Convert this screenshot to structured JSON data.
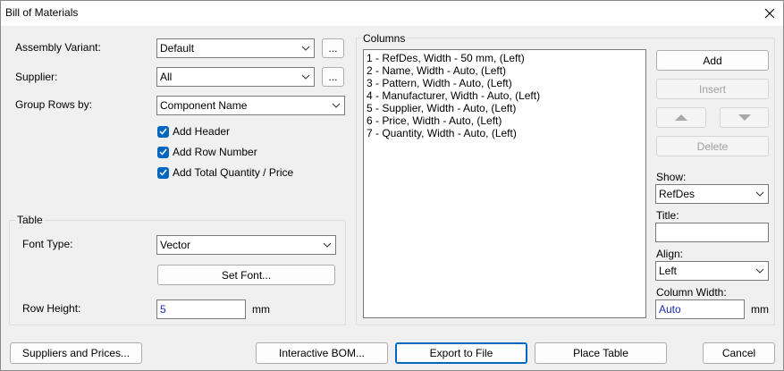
{
  "window": {
    "title": "Bill of Materials"
  },
  "assembly": {
    "label": "Assembly Variant:",
    "value": "Default",
    "more": "..."
  },
  "supplier": {
    "label": "Supplier:",
    "value": "All",
    "more": "..."
  },
  "group_rows": {
    "label": "Group Rows by:",
    "value": "Component Name"
  },
  "checks": [
    {
      "label": "Add Header",
      "checked": true
    },
    {
      "label": "Add Row Number",
      "checked": true
    },
    {
      "label": "Add Total Quantity / Price",
      "checked": true
    }
  ],
  "table": {
    "title": "Table",
    "font_type_label": "Font Type:",
    "font_type_value": "Vector",
    "set_font": "Set Font...",
    "row_height_label": "Row Height:",
    "row_height_value": "5",
    "row_height_unit": "mm"
  },
  "columns": {
    "title": "Columns",
    "items": [
      "1 - RefDes, Width - 50 mm, (Left)",
      "2 - Name, Width - Auto, (Left)",
      "3 - Pattern, Width - Auto, (Left)",
      "4 - Manufacturer, Width - Auto, (Left)",
      "5 - Supplier, Width - Auto, (Left)",
      "6 - Price, Width - Auto, (Left)",
      "7 - Quantity, Width - Auto, (Left)"
    ],
    "add": "Add",
    "insert": "Insert",
    "delete": "Delete",
    "show_label": "Show:",
    "show_value": "RefDes",
    "title_label": "Title:",
    "title_value": "",
    "align_label": "Align:",
    "align_value": "Left",
    "width_label": "Column Width:",
    "width_value": "Auto",
    "width_unit": "mm"
  },
  "footer": {
    "suppliers": "Suppliers and Prices...",
    "interactive": "Interactive BOM...",
    "export": "Export to File",
    "place": "Place Table",
    "cancel": "Cancel"
  }
}
